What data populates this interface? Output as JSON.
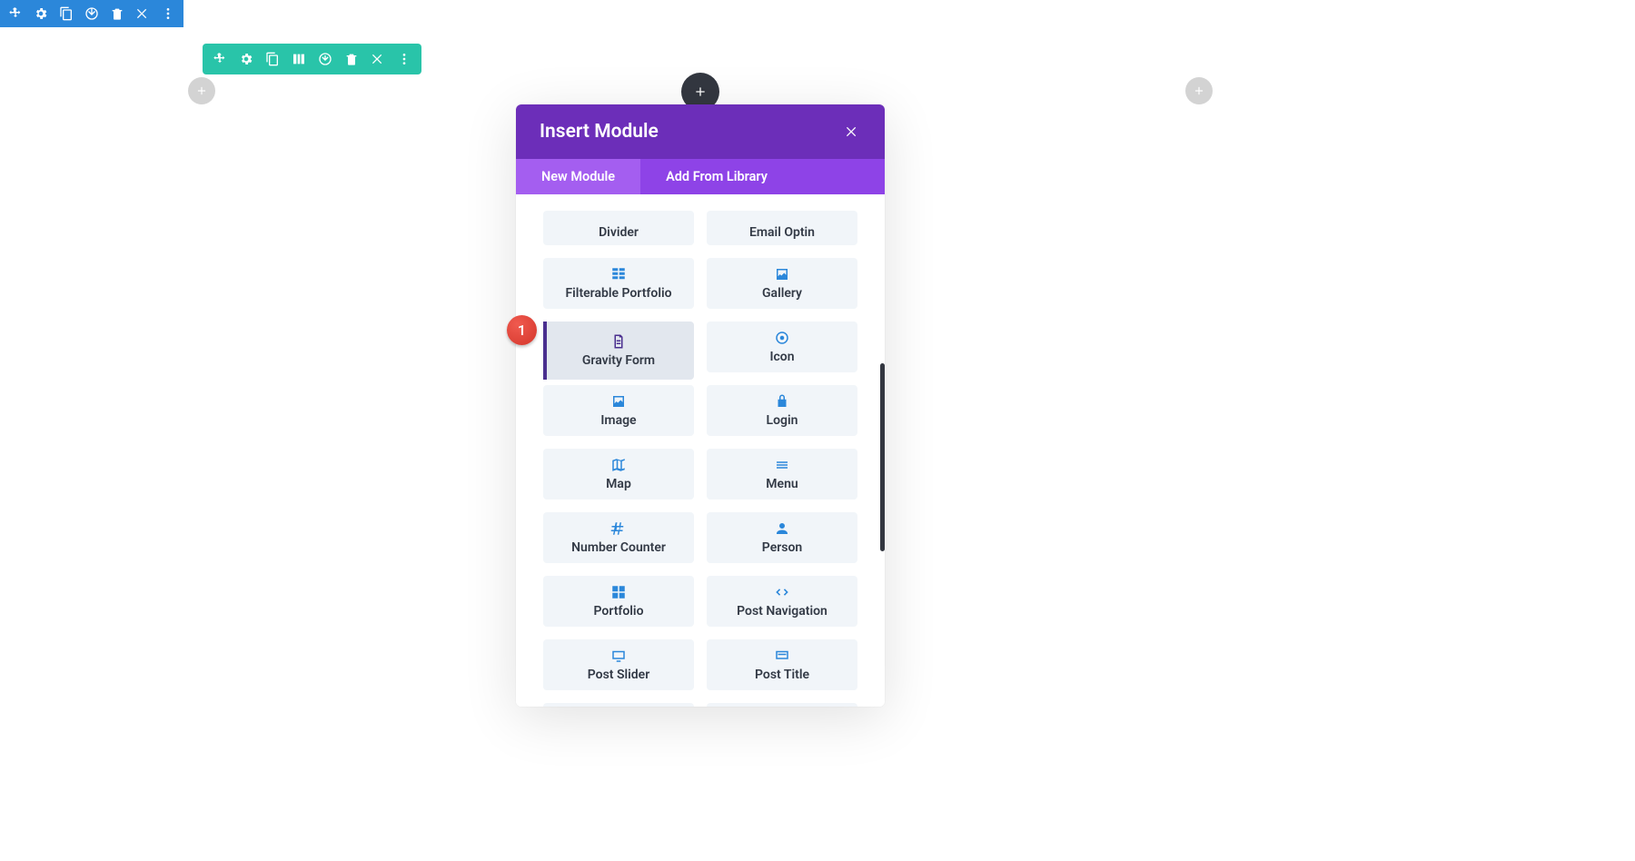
{
  "section_toolbar": {
    "icons": [
      "move",
      "settings",
      "duplicate",
      "save",
      "delete",
      "close",
      "more"
    ]
  },
  "row_toolbar": {
    "icons": [
      "move",
      "settings",
      "duplicate",
      "columns",
      "save",
      "delete",
      "close",
      "more"
    ]
  },
  "modal": {
    "title": "Insert Module",
    "tabs": {
      "new_module": "New Module",
      "add_from_library": "Add From Library"
    }
  },
  "modules": {
    "divider": "Divider",
    "email_optin": "Email Optin",
    "filterable_portfolio": "Filterable Portfolio",
    "gallery": "Gallery",
    "gravity_form": "Gravity Form",
    "icon": "Icon",
    "image": "Image",
    "login": "Login",
    "map": "Map",
    "menu": "Menu",
    "number_counter": "Number Counter",
    "person": "Person",
    "portfolio": "Portfolio",
    "post_navigation": "Post Navigation",
    "post_slider": "Post Slider",
    "post_title": "Post Title"
  },
  "annotation": {
    "badge1": "1"
  }
}
